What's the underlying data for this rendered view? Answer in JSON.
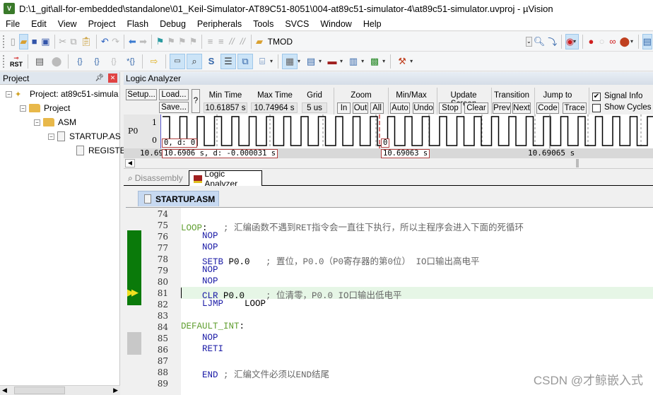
{
  "window": {
    "title": "D:\\1_git\\all-for-embedded\\standalone\\01_Keil-Simulator-AT89C51-8051\\004-at89c51-simulator-4\\at89c51-simulator.uvproj - µVision",
    "app_icon": "uvision-icon"
  },
  "menu": [
    "File",
    "Edit",
    "View",
    "Project",
    "Flash",
    "Debug",
    "Peripherals",
    "Tools",
    "SVCS",
    "Window",
    "Help"
  ],
  "toolbar1": {
    "icons": [
      "new-file-icon",
      "open-folder-icon",
      "save-icon",
      "save-all-icon",
      "cut-icon",
      "copy-icon",
      "paste-icon",
      "undo-icon",
      "redo-icon",
      "nav-back-icon",
      "nav-forward-icon",
      "bookmark-icon",
      "prev-bookmark-icon",
      "next-bookmark-icon",
      "clear-bookmarks-icon",
      "indent-icon",
      "unindent-icon",
      "comment-icon",
      "uncomment-icon",
      "find-in-files-icon"
    ],
    "find_value": "TMOD",
    "right_icons": [
      "find-icon",
      "incremental-find-icon",
      "debug-session-icon",
      "breakpoint-insert-icon",
      "breakpoint-enable-icon",
      "breakpoint-disable-icon",
      "breakpoint-kill-icon",
      "window-layout-icon"
    ]
  },
  "toolbar2": {
    "icons": [
      "reset-icon",
      "run-icon",
      "stop-icon",
      "step-into-icon",
      "step-over-icon",
      "step-out-icon",
      "run-to-cursor-icon",
      "show-next-statement-icon",
      "command-window-icon",
      "disassembly-window-icon",
      "symbols-window-icon",
      "registers-window-icon",
      "call-stack-icon",
      "watch-windows-icon",
      "memory-windows-icon",
      "serial-windows-icon",
      "analysis-windows-icon",
      "trace-windows-icon",
      "system-viewer-icon",
      "toolbox-icon"
    ],
    "reset_label": "RST"
  },
  "project_panel": {
    "title": "Project",
    "tree": [
      {
        "label": "Project: at89c51-simula",
        "level": 0
      },
      {
        "label": "Project",
        "level": 1
      },
      {
        "label": "ASM",
        "level": 2
      },
      {
        "label": "STARTUP.AS",
        "level": 3
      },
      {
        "label": "REGISTE",
        "level": 4
      }
    ]
  },
  "logic_analyzer": {
    "title": "Logic Analyzer",
    "buttons": {
      "setup": "Setup...",
      "load": "Load...",
      "save": "Save...",
      "help": "?"
    },
    "min_time_label": "Min Time",
    "min_time": "10.61857 s",
    "max_time_label": "Max Time",
    "max_time": "10.74964 s",
    "grid_label": "Grid",
    "grid": "5 us",
    "zoom_label": "Zoom",
    "zoom_in": "In",
    "zoom_out": "Out",
    "zoom_all": "All",
    "minmax_label": "Min/Max",
    "auto": "Auto",
    "undo": "Undo",
    "update_label": "Update Screen",
    "stop": "Stop",
    "clear": "Clear",
    "transition_label": "Transition",
    "prev": "Prev",
    "next": "Next",
    "jump_label": "Jump to",
    "code": "Code",
    "trace": "Trace",
    "signal_info": {
      "label": "Signal Info",
      "checked": true
    },
    "show_cycles": {
      "label": "Show Cycles",
      "checked": false
    },
    "signal": {
      "name": "P0",
      "high": "1",
      "low": "0"
    },
    "left_value": "0,   d: 0",
    "cursor_value": "0",
    "time_left": "10.690",
    "time_box_left": "10.6906 s,   d: -0.000031 s",
    "time_box_cursor": "10.69063 s",
    "time_center": "10.69065 s"
  },
  "bottom_tabs": [
    {
      "label": "Disassembly",
      "active": false
    },
    {
      "label": "Logic Analyzer",
      "active": true
    }
  ],
  "editor": {
    "file_tab": "STARTUP.ASM",
    "current_line": 81,
    "lines": [
      {
        "n": "74",
        "code": ""
      },
      {
        "n": "75",
        "label": "LOOP",
        "rest": ":   ",
        "comment": "; 汇编函数不遇到RET指令会一直往下执行，所以主程序会进入下面的死循环"
      },
      {
        "n": "76",
        "kw": "    NOP"
      },
      {
        "n": "77",
        "kw": "    NOP"
      },
      {
        "n": "78",
        "kw": "    SETB",
        "rest": " P0.0   ",
        "comment": "; 置位，P0.0（P0寄存器的第0位） IO口输出高电平"
      },
      {
        "n": "79",
        "kw": "    NOP"
      },
      {
        "n": "80",
        "kw": "    NOP"
      },
      {
        "n": "81",
        "kw": "    CLR",
        "rest": " P0.0    ",
        "comment": "; 位清零，P0.0 IO口输出低电平"
      },
      {
        "n": "82",
        "kw": "    LJMP",
        "rest": "    LOOP"
      },
      {
        "n": "83",
        "code": ""
      },
      {
        "n": "84",
        "label": "DEFAULT_INT",
        "rest": ":"
      },
      {
        "n": "85",
        "kw": "    NOP"
      },
      {
        "n": "86",
        "kw": "    RETI"
      },
      {
        "n": "87",
        "code": ""
      },
      {
        "n": "88",
        "kw": "    END",
        "rest": " ",
        "comment": "; 汇编文件必须以END结尾"
      },
      {
        "n": "89",
        "code": ""
      }
    ]
  },
  "watermark": "CSDN @才鲸嵌入式",
  "colors": {
    "coverage_green": "#0a7a0a",
    "keyword": "#1a1aa6",
    "label": "#5f9e2f",
    "comment": "#666666",
    "current_line": "#e6f6e6",
    "tab_active": "#c7d9f1"
  }
}
